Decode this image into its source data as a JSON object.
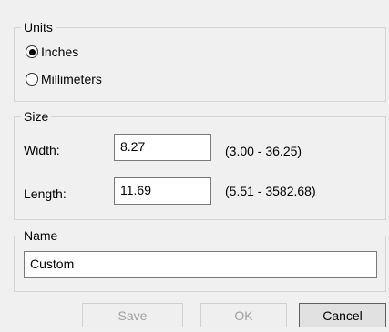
{
  "units": {
    "legend": "Units",
    "options": [
      {
        "label": "Inches",
        "selected": true
      },
      {
        "label": "Millimeters",
        "selected": false
      }
    ]
  },
  "size": {
    "legend": "Size",
    "width": {
      "label": "Width:",
      "value": "8.27",
      "range": "(3.00 - 36.25)"
    },
    "length": {
      "label": "Length:",
      "value": "11.69",
      "range": "(5.51 - 3582.68)"
    }
  },
  "name": {
    "legend": "Name",
    "value": "Custom"
  },
  "buttons": {
    "save": "Save",
    "ok": "OK",
    "cancel": "Cancel"
  }
}
